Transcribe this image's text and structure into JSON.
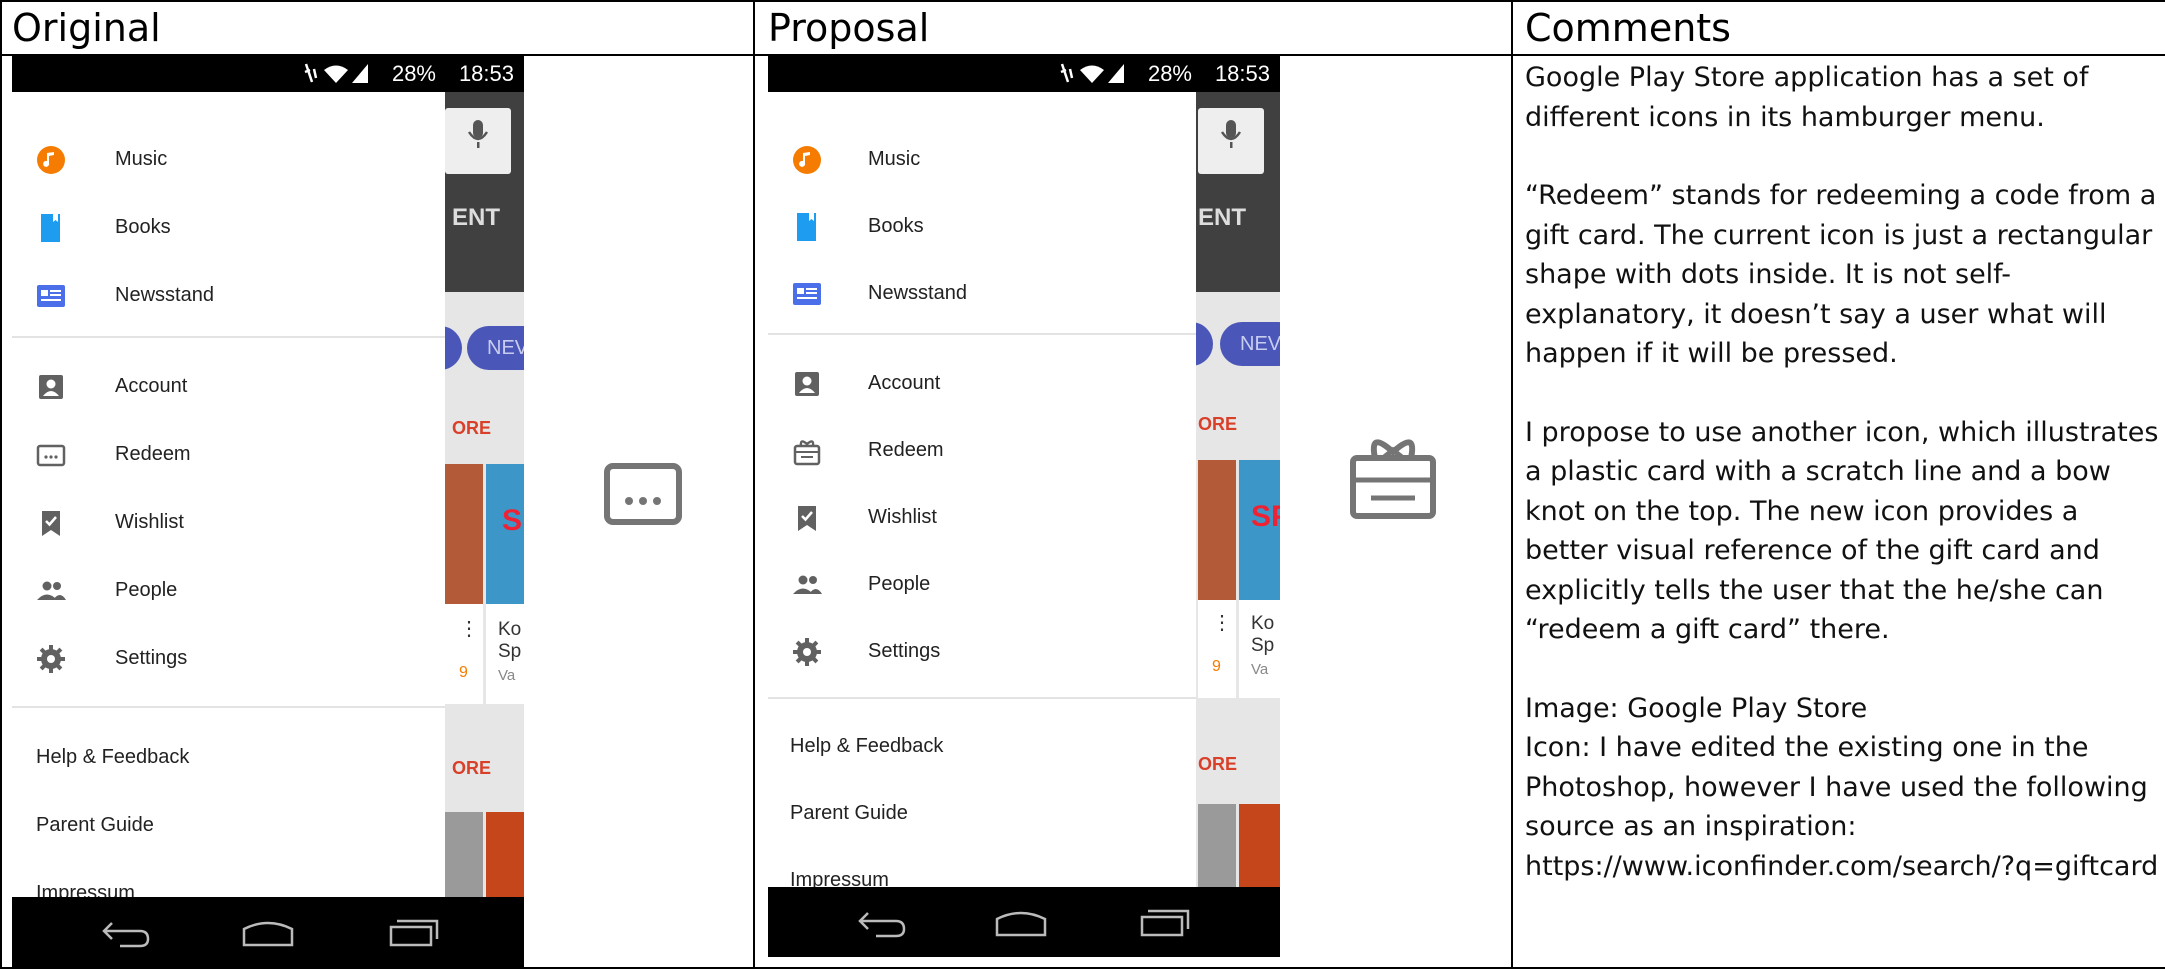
{
  "columns": {
    "original": "Original",
    "proposal": "Proposal",
    "comments": "Comments"
  },
  "status_bar": {
    "battery": "28%",
    "time": "18:53",
    "icons": [
      "mute-icon",
      "wifi-icon",
      "signal-icon"
    ]
  },
  "app_background": {
    "tab_fragment": "ENT",
    "pill_fragment": "NEV",
    "more_label": "ORE",
    "card_title_fragment": "Ko",
    "card_subtitle_fragment": "Sp",
    "card_meta_fragment": "Va",
    "price_fragment": "9"
  },
  "drawer": {
    "apps": [
      {
        "label": "Music",
        "icon": "music-icon",
        "color": "#f57c00"
      },
      {
        "label": "Books",
        "icon": "books-icon",
        "color": "#1e9cf0"
      },
      {
        "label": "Newsstand",
        "icon": "newsstand-icon",
        "color": "#4a6fe8"
      }
    ],
    "account_items": [
      {
        "label": "Account",
        "icon": "account-icon"
      },
      {
        "label": "Redeem",
        "icon": "redeem-icon"
      },
      {
        "label": "Wishlist",
        "icon": "wishlist-icon"
      },
      {
        "label": "People",
        "icon": "people-icon"
      },
      {
        "label": "Settings",
        "icon": "settings-icon"
      }
    ],
    "footer_items": [
      "Help & Feedback",
      "Parent Guide",
      "Impressum"
    ]
  },
  "comments": {
    "p1": "Google Play Store application has a set of different icons in its hamburger menu.",
    "p2": "“Redeem” stands for redeeming a code from a gift card. The current icon is just a rectangular shape with dots inside. It is not self-explanatory, it doesn’t say a user what will happen if it will be pressed.",
    "p3": "I propose to use another icon, which illustrates a plastic card with a scratch line and a bow knot on the top. The new icon provides a better visual reference of the gift card and explicitly tells the user that the he/she can “redeem a gift card” there.",
    "source_image": "Image: Google Play Store",
    "source_icon": "Icon: I have edited the existing one in the Photoshop, however I have used the following source as an inspiration:",
    "source_url": "https://www.iconfinder.com/search/?q=giftcard"
  },
  "colors": {
    "status_bar": "#000000",
    "icon_grey": "#616161",
    "accent_pill": "#4a56b8",
    "more_red": "#d9402a"
  }
}
